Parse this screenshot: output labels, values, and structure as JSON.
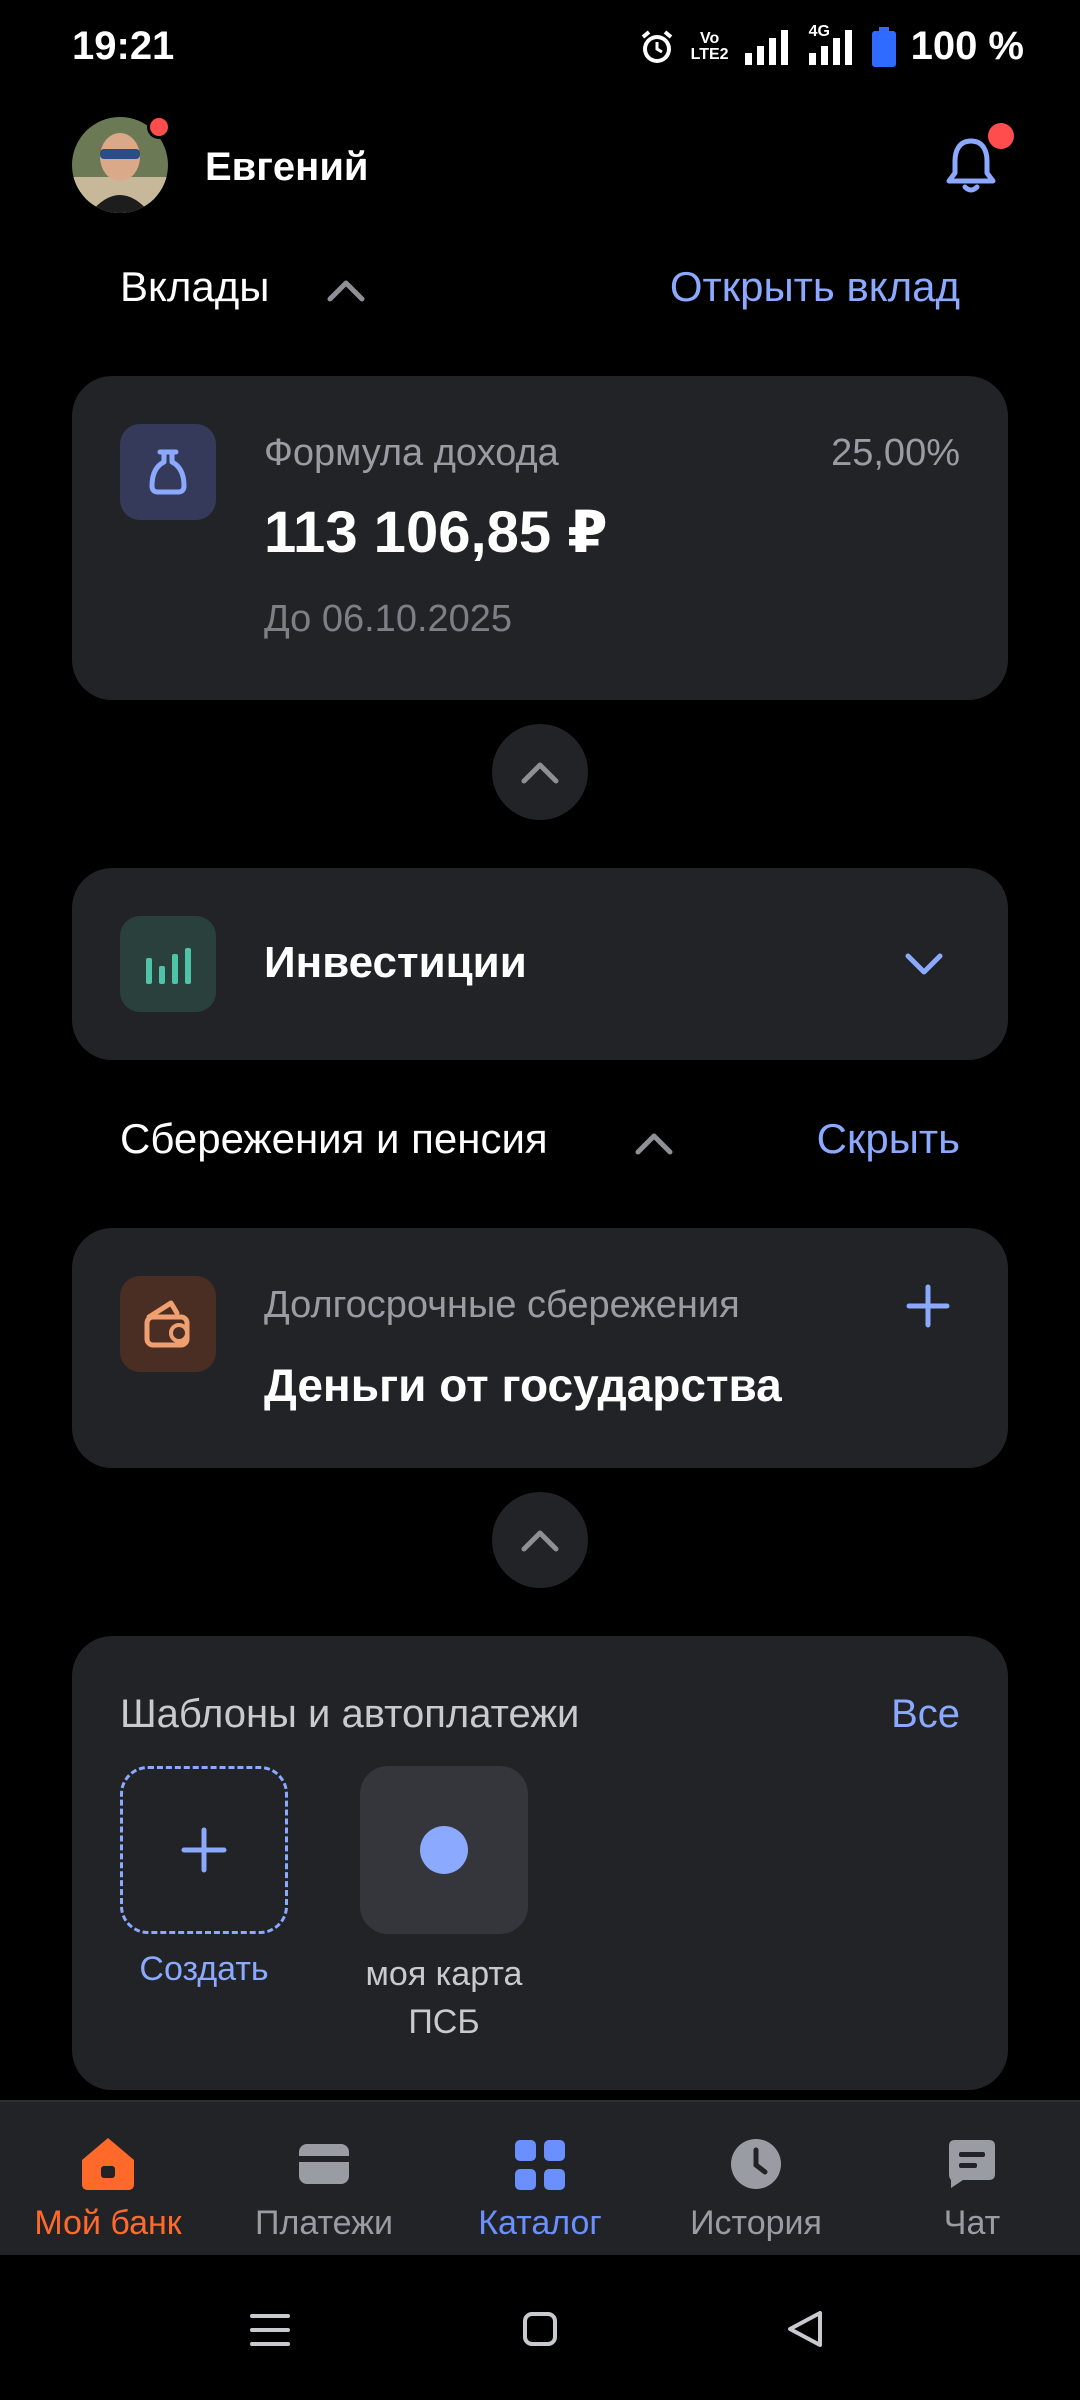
{
  "status": {
    "time": "19:21",
    "battery_pct": "100 %",
    "volte_top": "Vo",
    "volte_bottom": "LTE2",
    "net_type": "4G",
    "battery_level": 1.0
  },
  "header": {
    "user_name": "Евгений",
    "avatar_icon": "user-avatar",
    "bell_icon": "bell-icon"
  },
  "deposits": {
    "title": "Вклады",
    "open_link": "Открыть вклад",
    "card": {
      "name": "Формула дохода",
      "rate": "25,00%",
      "amount": "113 106,85 ₽",
      "until": "До 06.10.2025",
      "icon": "piggy-bag-icon"
    }
  },
  "investments": {
    "title": "Инвестиции",
    "icon": "bar-chart-icon"
  },
  "savings": {
    "title": "Сбережения и пенсия",
    "hide_link": "Скрыть",
    "card": {
      "subtitle": "Долгосрочные сбережения",
      "name": "Деньги от государства",
      "icon": "wallet-icon"
    }
  },
  "templates": {
    "title": "Шаблоны и автоплатежи",
    "all_link": "Все",
    "create_label": "Создать",
    "items": [
      {
        "label_line1": "моя карта",
        "label_line2": "ПСБ"
      }
    ]
  },
  "nav": {
    "items": [
      {
        "label": "Мой банк",
        "icon": "home-icon"
      },
      {
        "label": "Платежи",
        "icon": "wallet-icon"
      },
      {
        "label": "Каталог",
        "icon": "grid-icon"
      },
      {
        "label": "История",
        "icon": "clock-icon"
      },
      {
        "label": "Чат",
        "icon": "chat-icon"
      }
    ]
  },
  "colors": {
    "background": "#000000",
    "card": "#222327",
    "accent_blue": "#8aa9ff",
    "active_orange": "#ff6a2b",
    "notification_red": "#ff4d4d"
  }
}
